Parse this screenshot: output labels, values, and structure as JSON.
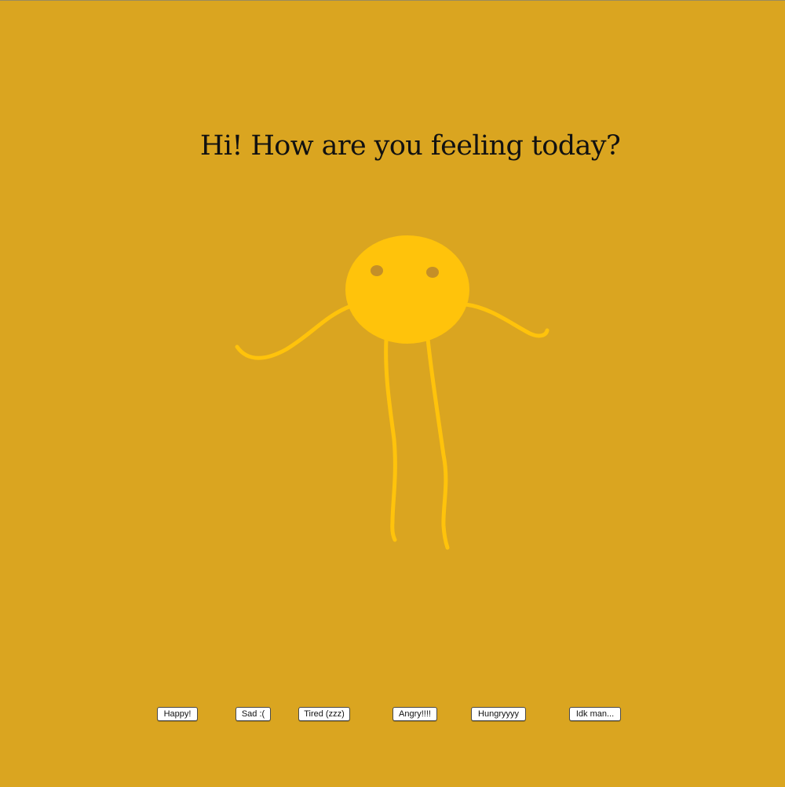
{
  "heading": "Hi! How are you feeling today?",
  "colors": {
    "background": "#DAA520",
    "character": "#FFC30B",
    "eyes": "#C48F28",
    "button_bg": "#FFFFFF"
  },
  "character": {
    "name": "yellow-blob-character"
  },
  "mood_buttons": [
    {
      "label": "Happy!"
    },
    {
      "label": "Sad :("
    },
    {
      "label": "Tired (zzz)"
    },
    {
      "label": "Angry!!!!"
    },
    {
      "label": "Hungryyyy"
    },
    {
      "label": "Idk man..."
    }
  ]
}
